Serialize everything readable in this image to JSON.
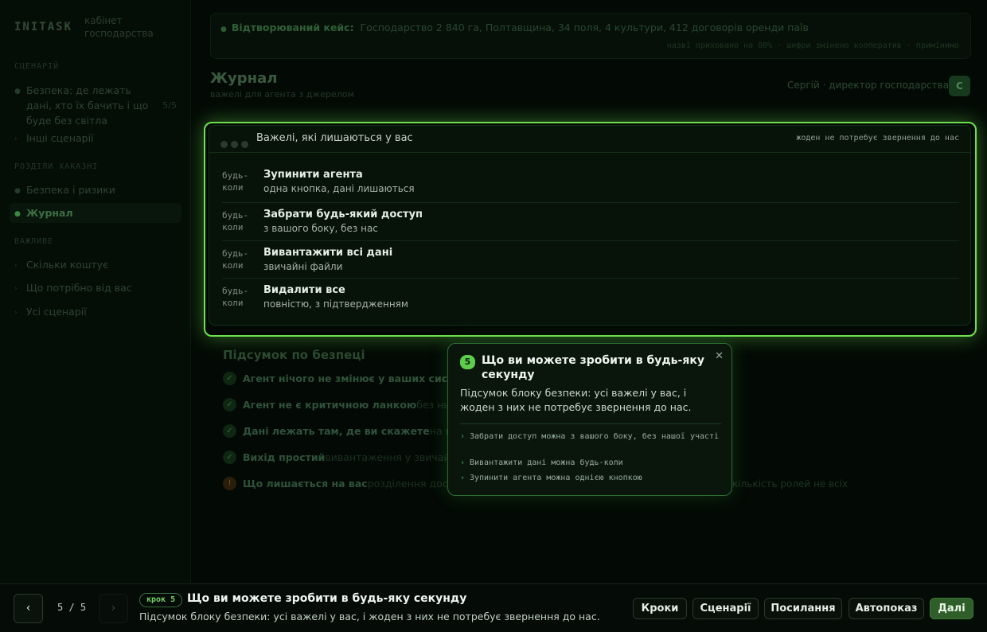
{
  "sidebar": {
    "logo": "INITASK",
    "logo_sub": "кабінет господарства",
    "sections": [
      {
        "label": "СЦЕНАРІЙ"
      },
      {
        "label": "РОЗДІЛИ ХАКАЗНІ"
      },
      {
        "label": "ВАЖЛИВЕ"
      }
    ],
    "items": [
      {
        "label": "Безпека: де лежать дані, хто їх бачить і що буде без світла",
        "count": "5/5"
      },
      {
        "label": "Інші сценарії"
      },
      {
        "label": "Безпека і ризики"
      },
      {
        "label": "Журнал"
      },
      {
        "label": "Скільки коштує"
      },
      {
        "label": "Що потрібно від вас"
      },
      {
        "label": "Усі сценарії"
      }
    ]
  },
  "banner": {
    "label": "Відтворюваний кейс:",
    "text": "Господарство 2 840 га, Полтавщина, 34 поля, 4 культури, 412 договорів оренди паїв",
    "sub": "назві приховано на 80% · шифри змінено кооператив · примінимо"
  },
  "page": {
    "title": "Журнал",
    "subtitle": "важелі для агента з джерелом",
    "user": "Сергій · директор господарства",
    "user_button": "С"
  },
  "card": {
    "title": "Важелі, які лишаються у вас",
    "right": "жоден не потребує звернення до нас",
    "rows": [
      {
        "when": "будь-коли",
        "title": "Зупинити агента",
        "desc": "одна кнопка, дані лишаються"
      },
      {
        "when": "будь-коли",
        "title": "Забрати будь-який доступ",
        "desc": "з вашого боку, без нас"
      },
      {
        "when": "будь-коли",
        "title": "Вивантажити всі дані",
        "desc": "звичайні файли"
      },
      {
        "when": "будь-коли",
        "title": "Видалити все",
        "desc": "повністю, з підтвердженням"
      }
    ]
  },
  "summary": {
    "title": "Підсумок по безпеці",
    "rows": [
      {
        "icon": "✓",
        "title": "Агент нічого не змінює у ваших сист",
        "rest": ""
      },
      {
        "icon": "✓",
        "title": "Агент не є критичною ланкою",
        "rest": "без нього"
      },
      {
        "icon": "✓",
        "title": "Дані лежать там, де ви скажете",
        "rest": "на вашому"
      },
      {
        "icon": "✓",
        "title": "Вихід простий",
        "rest": "вивантаження у звичайні"
      },
      {
        "icon": "!",
        "title": "Що лишається на вас",
        "rest": "розділення доступ"
      }
    ],
    "tail": "кількість ролей не всіх"
  },
  "popover": {
    "num": "5",
    "title": "Що ви можете зробити в будь-яку секунду",
    "close": "✕",
    "desc": "Підсумок блоку безпеки: усі важелі у вас, і жоден з них не потребує звернення до нас.",
    "items": [
      "Забрати доступ можна з вашого боку, без нашої участі",
      "Вивантажити дані можна будь-коли",
      "Зупинити агента можна однією кнопкою"
    ]
  },
  "footer": {
    "prev": "‹",
    "next": "›",
    "count": "5 / 5",
    "step": "крок 5",
    "title": "Що ви можете зробити в будь-яку секунду",
    "desc": "Підсумок блоку безпеки: усі важелі у вас, і жоден з них не потребує звернення до нас.",
    "buttons": [
      "Кроки",
      "Сценарії",
      "Посилання",
      "Автопоказ",
      "Далі"
    ]
  }
}
